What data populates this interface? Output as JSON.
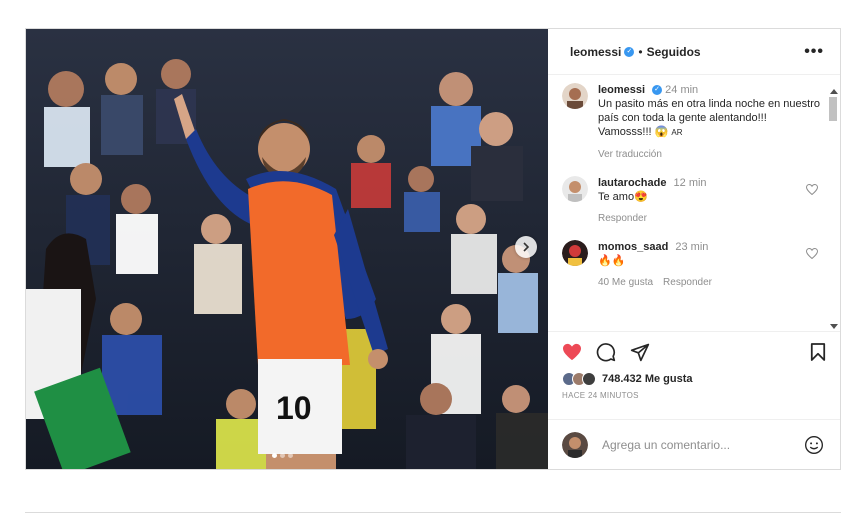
{
  "post": {
    "header": {
      "username": "leomessi",
      "separator": "•",
      "follow_status": "Seguidos",
      "more_label": "•••"
    },
    "caption": {
      "username": "leomessi",
      "time": "24 min",
      "text": "Un pasito más en otra linda noche en nuestro país con toda la gente alentando!!! Vamosss!!! 😱",
      "flag": "AR",
      "translate_label": "Ver traducción"
    },
    "comments": [
      {
        "username": "lautarochade",
        "time": "12 min",
        "text": "Te amo😍",
        "reply_label": "Responder"
      },
      {
        "username": "momos_saad",
        "time": "23 min",
        "text": "🔥🔥",
        "likes_label": "40 Me gusta",
        "reply_label": "Responder"
      }
    ],
    "likes_text": "748.432 Me gusta",
    "timestamp": "HACE 24 MINUTOS",
    "comment_placeholder": "Agrega un comentario...",
    "jersey_number": "10",
    "colors": {
      "heart_liked": "#ed4956",
      "verified": "#3897f0",
      "bib": "#f26a2a",
      "jersey": "#1d3a8f"
    },
    "icons": [
      "heart-icon",
      "comment-icon",
      "share-icon",
      "bookmark-icon",
      "emoji-icon",
      "chevron-right-icon",
      "verified-icon",
      "more-icon"
    ]
  }
}
